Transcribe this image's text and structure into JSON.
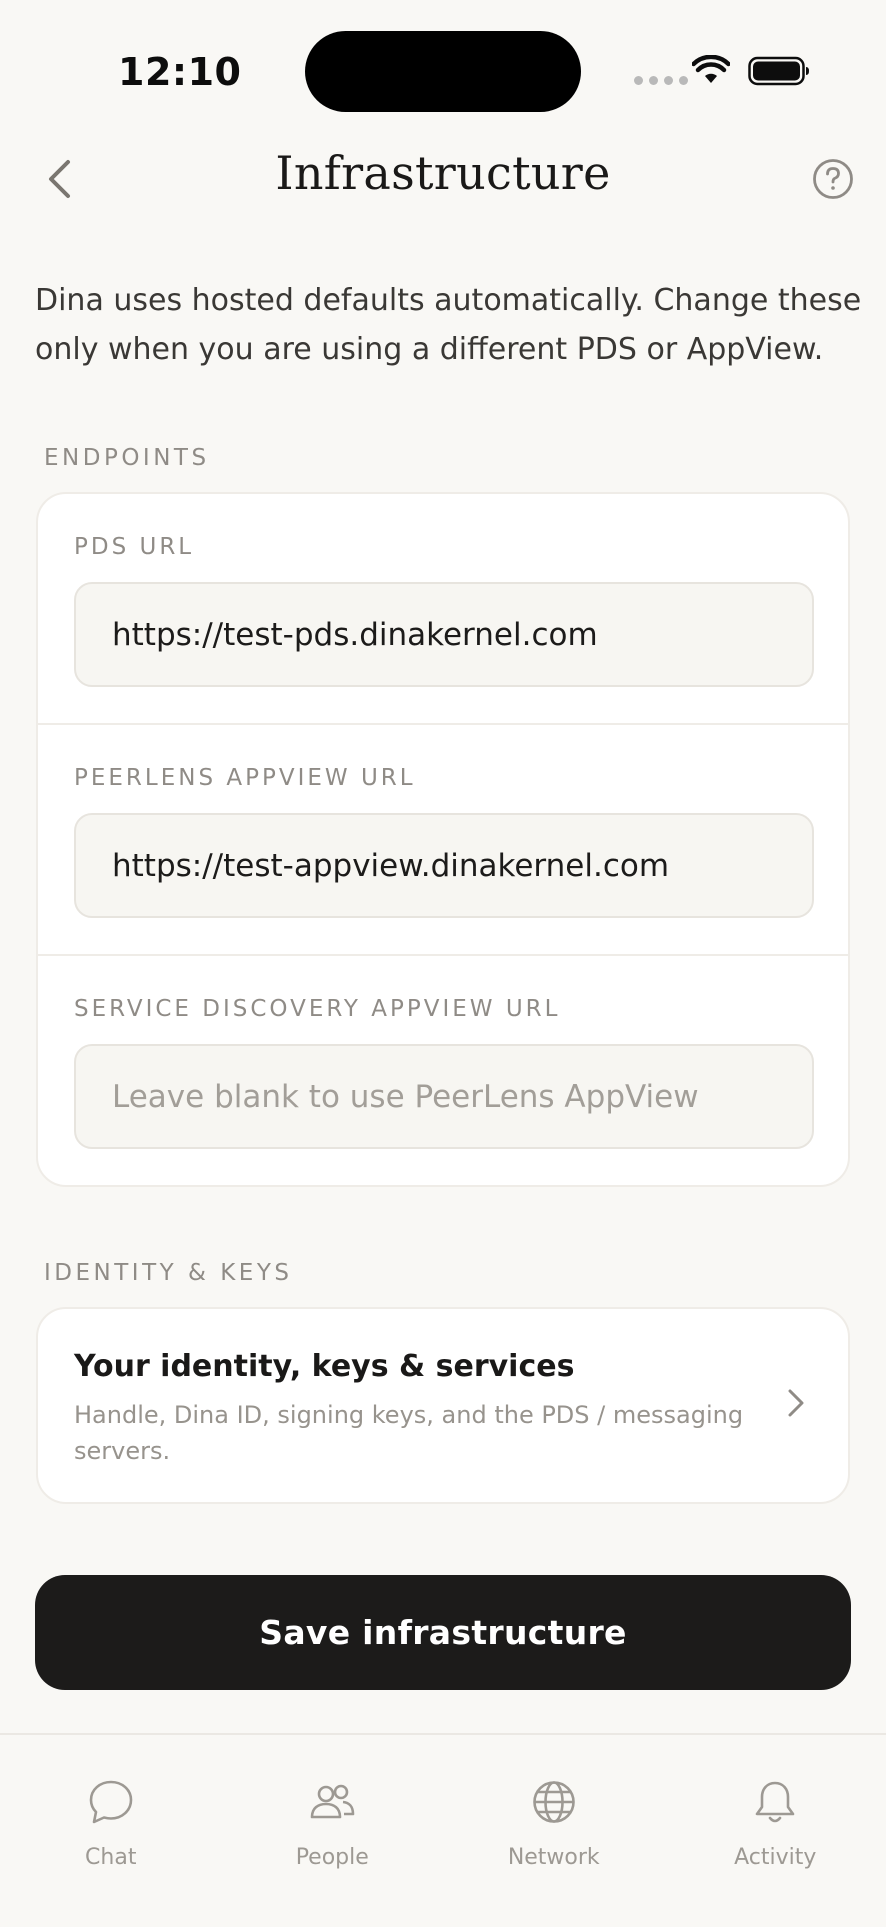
{
  "status_bar": {
    "time": "12:10"
  },
  "header": {
    "title": "Infrastructure"
  },
  "intro": "Dina uses hosted defaults automatically. Change these only when you are using a different PDS or AppView.",
  "endpoints": {
    "section_label": "ENDPOINTS",
    "fields": [
      {
        "label": "PDS URL",
        "value": "https://test-pds.dinakernel.com",
        "placeholder": ""
      },
      {
        "label": "PEERLENS APPVIEW URL",
        "value": "https://test-appview.dinakernel.com",
        "placeholder": ""
      },
      {
        "label": "SERVICE DISCOVERY APPVIEW URL",
        "value": "",
        "placeholder": "Leave blank to use PeerLens AppView"
      }
    ]
  },
  "identity": {
    "section_label": "IDENTITY & KEYS",
    "title": "Your identity, keys & services",
    "subtitle": "Handle, Dina ID, signing keys, and the PDS / messaging servers."
  },
  "save_button": "Save infrastructure",
  "tabs": [
    {
      "label": "Chat",
      "icon": "chat-bubble-icon"
    },
    {
      "label": "People",
      "icon": "people-icon"
    },
    {
      "label": "Network",
      "icon": "globe-icon"
    },
    {
      "label": "Activity",
      "icon": "bell-icon"
    }
  ],
  "colors": {
    "primary": "#1c1b1a",
    "background": "#f9f8f5",
    "muted": "#8f8b86"
  }
}
